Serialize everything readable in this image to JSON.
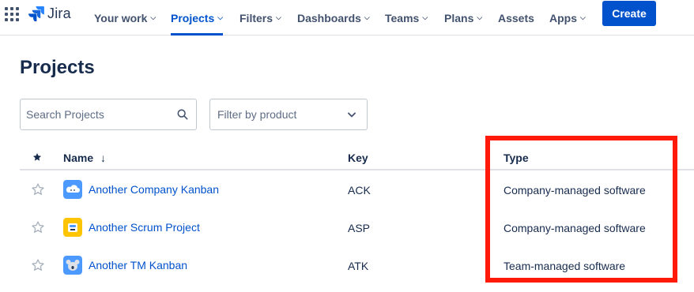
{
  "nav": {
    "logo_text": "Jira",
    "items": [
      {
        "label": "Your work",
        "chevron": true,
        "active": false
      },
      {
        "label": "Projects",
        "chevron": true,
        "active": true
      },
      {
        "label": "Filters",
        "chevron": true,
        "active": false
      },
      {
        "label": "Dashboards",
        "chevron": true,
        "active": false
      },
      {
        "label": "Teams",
        "chevron": true,
        "active": false
      },
      {
        "label": "Plans",
        "chevron": true,
        "active": false
      },
      {
        "label": "Assets",
        "chevron": false,
        "active": false
      },
      {
        "label": "Apps",
        "chevron": true,
        "active": false
      }
    ],
    "create_label": "Create"
  },
  "page": {
    "title": "Projects",
    "search_placeholder": "Search Projects",
    "filter_placeholder": "Filter by product"
  },
  "table": {
    "headers": {
      "name": "Name",
      "key": "Key",
      "type": "Type"
    },
    "sort_indicator": "↓",
    "rows": [
      {
        "name": "Another Company Kanban",
        "key": "ACK",
        "type": "Company-managed software",
        "icon": "cloud-avatar-icon",
        "icon_color": "#4c9aff"
      },
      {
        "name": "Another Scrum Project",
        "key": "ASP",
        "type": "Company-managed software",
        "icon": "robot-avatar-icon",
        "icon_color": "#ffc400"
      },
      {
        "name": "Another TM Kanban",
        "key": "ATK",
        "type": "Team-managed software",
        "icon": "koala-avatar-icon",
        "icon_color": "#4c9aff"
      }
    ]
  },
  "colors": {
    "brand": "#0052cc",
    "highlight": "#ff1a0a"
  }
}
